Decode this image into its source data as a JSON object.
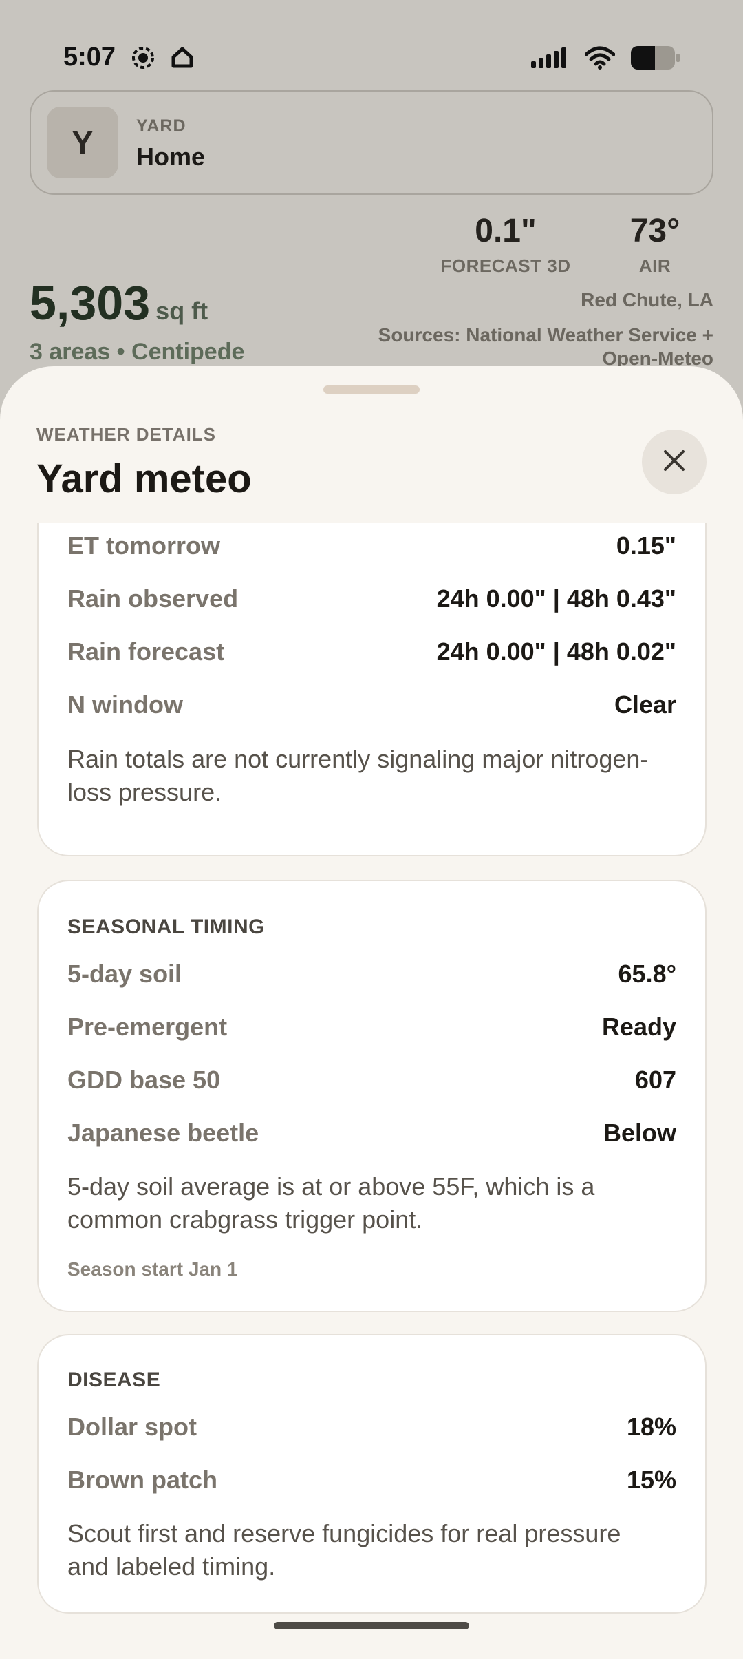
{
  "status": {
    "time": "5:07",
    "left_icons": [
      "record-icon",
      "home-icon"
    ],
    "right_icons": [
      "signal-icon",
      "wifi-icon",
      "battery-icon"
    ]
  },
  "yard": {
    "avatar_letter": "Y",
    "kicker": "YARD",
    "name": "Home"
  },
  "metrics": {
    "forecast_value": "0.1\"",
    "forecast_label": "FORECAST 3D",
    "air_value": "73°",
    "air_label": "AIR"
  },
  "area": {
    "value": "5,303",
    "unit": "sq ft",
    "sub": "3 areas • Centipede"
  },
  "location": "Red Chute, LA",
  "sources": "Sources: National Weather Service + Open-Meteo",
  "sheet": {
    "kicker": "WEATHER DETAILS",
    "title": "Yard meteo",
    "close_icon": "close-icon"
  },
  "card_water": {
    "rows": [
      {
        "label": "ET tomorrow",
        "value": "0.15\""
      },
      {
        "label": "Rain observed",
        "value": "24h 0.00\" | 48h 0.43\""
      },
      {
        "label": "Rain forecast",
        "value": "24h 0.00\" | 48h 0.02\""
      },
      {
        "label": "N window",
        "value": "Clear"
      }
    ],
    "note": "Rain totals are not currently signaling major nitrogen-loss pressure."
  },
  "card_season": {
    "heading": "SEASONAL TIMING",
    "rows": [
      {
        "label": "5-day soil",
        "value": "65.8°"
      },
      {
        "label": "Pre-emergent",
        "value": "Ready"
      },
      {
        "label": "GDD base 50",
        "value": "607"
      },
      {
        "label": "Japanese beetle",
        "value": "Below"
      }
    ],
    "note": "5-day soil average is at or above 55F, which is a common crabgrass trigger point.",
    "foot": "Season start Jan 1"
  },
  "card_disease": {
    "heading": "DISEASE",
    "rows": [
      {
        "label": "Dollar spot",
        "value": "18%"
      },
      {
        "label": "Brown patch",
        "value": "15%"
      }
    ],
    "note": "Scout first and reserve fungicides for real pressure and labeled timing."
  }
}
